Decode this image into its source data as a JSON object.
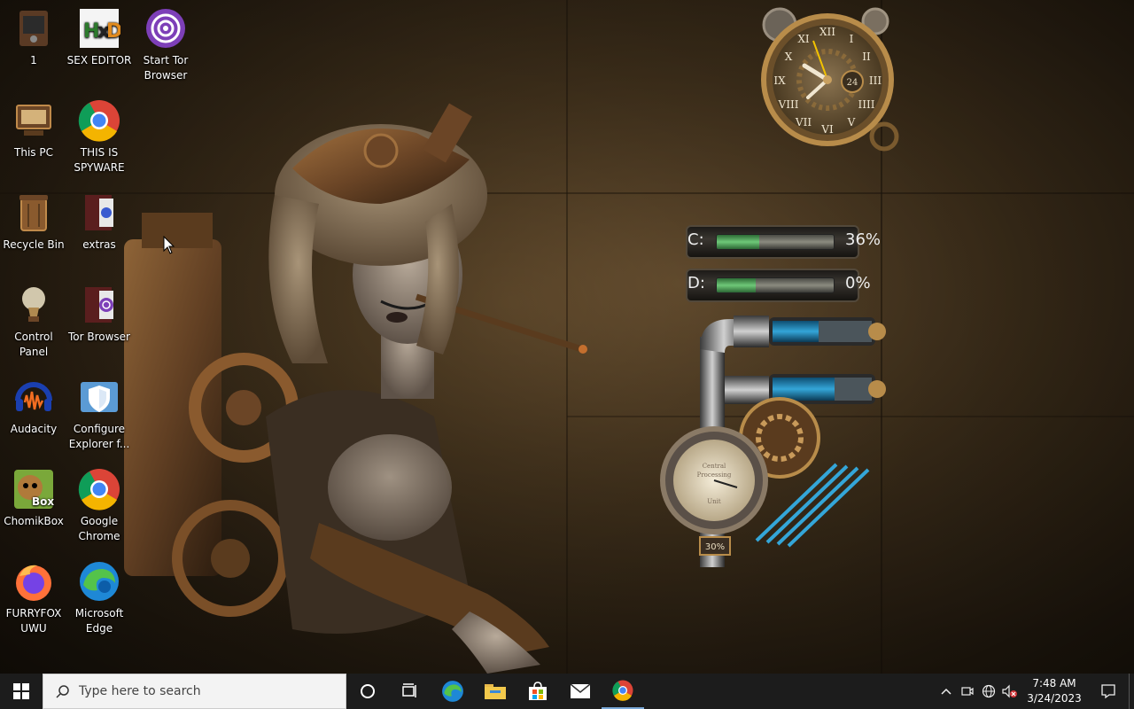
{
  "desktop": {
    "icons": [
      {
        "id": "1",
        "label": "1",
        "icon": "tv-game-icon"
      },
      {
        "id": "sex-editor",
        "label": "SEX EDITOR",
        "icon": "hxd-icon"
      },
      {
        "id": "start-tor",
        "label": "Start Tor Browser",
        "icon": "tor-icon"
      },
      {
        "id": "this-pc",
        "label": "This PC",
        "icon": "computer-icon"
      },
      {
        "id": "spyware",
        "label": "THIS IS SPYWARE",
        "icon": "chrome-icon"
      },
      {
        "id": "recycle",
        "label": "Recycle Bin",
        "icon": "recycle-bin-icon"
      },
      {
        "id": "extras",
        "label": "extras",
        "icon": "book-icon"
      },
      {
        "id": "control-panel",
        "label": "Control Panel",
        "icon": "lightbulb-icon"
      },
      {
        "id": "tor-browser",
        "label": "Tor Browser",
        "icon": "tor-folder-icon"
      },
      {
        "id": "audacity",
        "label": "Audacity",
        "icon": "audacity-icon"
      },
      {
        "id": "configure-explorer",
        "label": "Configure Explorer f...",
        "icon": "shield-icon"
      },
      {
        "id": "chomikbox",
        "label": "ChomikBox",
        "icon": "chomikbox-icon"
      },
      {
        "id": "google-chrome",
        "label": "Google Chrome",
        "icon": "chrome-icon"
      },
      {
        "id": "furryfox",
        "label": "FURRYFOX UWU",
        "icon": "firefox-icon"
      },
      {
        "id": "edge",
        "label": "Microsoft Edge",
        "icon": "edge-icon"
      }
    ]
  },
  "widgets": {
    "clock": {
      "center_label": "24",
      "numerals": [
        "XII",
        "I",
        "II",
        "III",
        "IIII",
        "V",
        "VI",
        "VII",
        "VIII",
        "IX",
        "X",
        "XI"
      ]
    },
    "drives": [
      {
        "letter": "C:",
        "percent_text": "36%",
        "fill_fraction": 0.36
      },
      {
        "letter": "D:",
        "percent_text": "0%",
        "fill_fraction": 0.33
      }
    ],
    "cpu_gauge": {
      "label_top": "Central",
      "label_mid": "Processing",
      "label_bot": "Unit",
      "percent_text": "30%"
    }
  },
  "taskbar": {
    "search_placeholder": "Type here to search",
    "pinned": [
      "cortana-circle-icon",
      "task-view-icon",
      "edge-icon",
      "file-explorer-icon",
      "store-icon",
      "mail-icon",
      "chrome-icon"
    ],
    "tray": {
      "time": "7:48 AM",
      "date": "3/24/2023"
    }
  },
  "colors": {
    "taskbar_bg": "#1c1c1c",
    "accent_gauge_green": "#6ec878",
    "accent_pipe_blue": "#34a6d8"
  }
}
